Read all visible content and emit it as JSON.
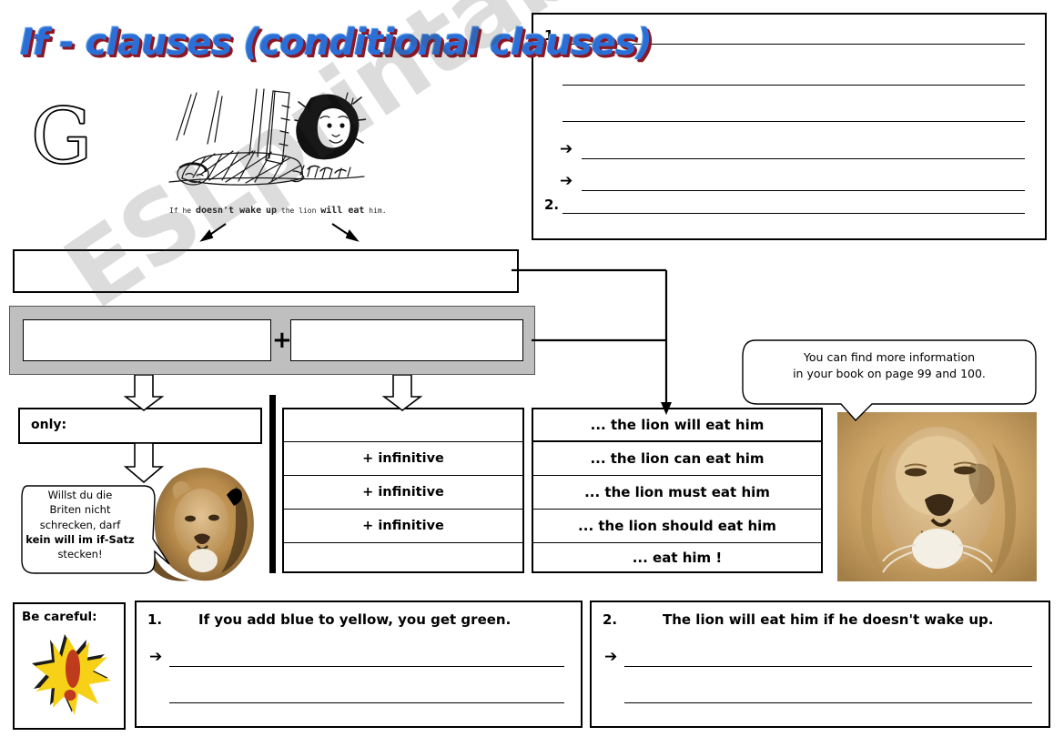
{
  "worksheet": {
    "title": "If - clauses (conditional clauses)",
    "grammar_marker": "G",
    "watermark": "ESLprintables.com"
  },
  "cartoon": {
    "caption_part1": "If",
    "caption_he": "he",
    "caption_part2": "doesn't wake",
    "caption_up": "up",
    "caption_the_lion": "the lion",
    "caption_will_eat": "will eat",
    "caption_him": "him.",
    "full_caption": "If he doesn't wake up the lion will eat him.",
    "alt": "sleeping man in sleeping bag with lion behind him"
  },
  "panel_top_right": {
    "item1_number": "1.",
    "item2_number": "2.",
    "arrow": "➔",
    "lines": 6
  },
  "structure": {
    "sentence_box_value": "",
    "left_part_value": "",
    "right_part_value": "",
    "plus": "+"
  },
  "columns": {
    "only_label": "only:",
    "middle_rows": [
      "",
      "+ infinitive",
      "+ infinitive",
      "+ infinitive",
      ""
    ],
    "right_rows": [
      "... the lion will eat him",
      "... the lion can eat him",
      "... the lion must eat him",
      "... the lion should eat him",
      "... eat him !"
    ]
  },
  "bubbles": {
    "german_line1": "Willst du die",
    "german_line2": "Briten nicht",
    "german_line3": "schrecken, darf",
    "german_bold": "kein will im if-Satz",
    "german_line5": "stecken!",
    "book_line1": "You can find more information",
    "book_line2": "in your book on page 99 and 100."
  },
  "bottom": {
    "careful_label": "Be careful:",
    "warning_icon": "exclamation-starburst",
    "exercise1_number": "1.",
    "exercise1_sentence": "If you add blue to yellow, you get green.",
    "exercise1_arrow": "➔",
    "exercise2_number": "2.",
    "exercise2_sentence": "The lion will eat him if he doesn't wake up.",
    "exercise2_arrow": "➔"
  },
  "colors": {
    "title_blue": "#2b6fd6",
    "title_red": "#8d1622",
    "gray_band": "#bfbfbf",
    "warn_yellow": "#f2cc15",
    "warn_red": "#c0301c"
  }
}
